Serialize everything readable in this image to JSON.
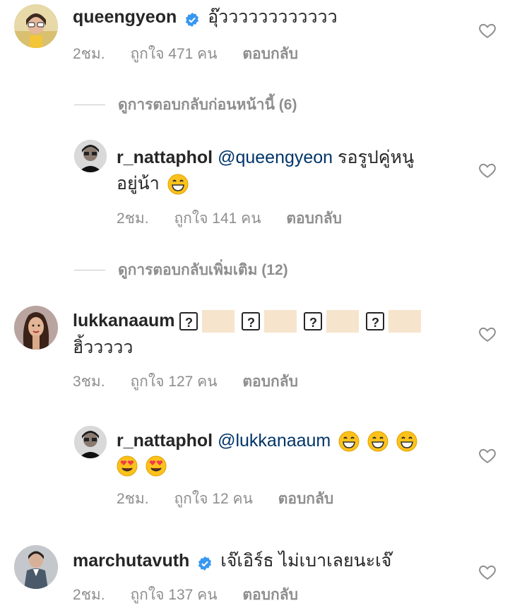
{
  "comments": [
    {
      "username": "queengyeon",
      "verified": true,
      "text": "อุ๊วววววววววววว",
      "time": "2ชม.",
      "likes": "ถูกใจ 471 คน",
      "reply": "ตอบกลับ",
      "avatar_icon": "profile-photo-woman-sunglasses"
    },
    {
      "username": "r_nattaphol",
      "mention": "@queengyeon",
      "text_line1": "รอรูปคู่หนู",
      "text_line2": "อยู่น้า",
      "emoji": "grinning-face",
      "time": "2ชม.",
      "likes": "ถูกใจ 141 คน",
      "reply": "ตอบกลับ",
      "avatar_icon": "profile-photo-man-dark"
    },
    {
      "username": "lukkanaaum",
      "box_glyph": "?",
      "text_line2": "ฮิ้ววววว",
      "time": "3ชม.",
      "likes": "ถูกใจ 127 คน",
      "reply": "ตอบกลับ",
      "avatar_icon": "profile-photo-woman-long-hair"
    },
    {
      "username": "r_nattaphol",
      "mention": "@lukkanaaum",
      "emojis_line1": [
        "grinning-face",
        "grinning-face",
        "grinning-face"
      ],
      "emojis_line2": [
        "heart-eyes-face",
        "heart-eyes-face"
      ],
      "time": "2ชม.",
      "likes": "ถูกใจ 12 คน",
      "reply": "ตอบกลับ",
      "avatar_icon": "profile-photo-man-dark"
    },
    {
      "username": "marchutavuth",
      "verified": true,
      "text": "เจ๊เอิร์ธ ไม่เบาเลยนะเจ๊",
      "time": "2ชม.",
      "likes": "ถูกใจ 137 คน",
      "reply": "ตอบกลับ",
      "avatar_icon": "profile-photo-man-standing"
    }
  ],
  "view_previous_replies": "ดูการตอบกลับก่อนหน้านี้ (6)",
  "view_more_replies": "ดูการตอบกลับเพิ่มเติม (12)",
  "colors": {
    "verified": "#3897f0",
    "meta": "#8e8e8e",
    "mention": "#003569",
    "heart_outline": "#8e8e8e"
  }
}
